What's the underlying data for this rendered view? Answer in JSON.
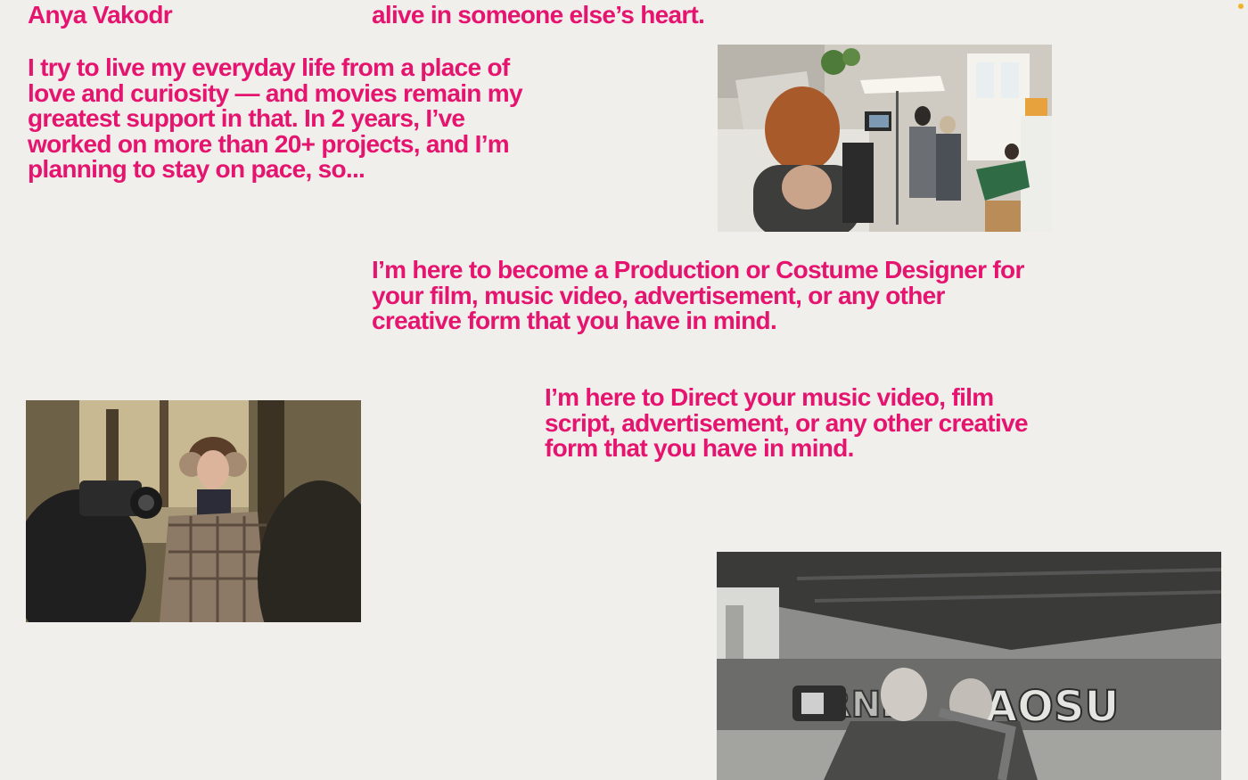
{
  "header": {
    "name": "Anya Vakodr",
    "quote_tail": "alive in someone else’s heart."
  },
  "intro": {
    "text": "I try to live my everyday life from a place of\nlove and curiosity  —  and movies remain my\ngreatest support in that. In 2 years, I’ve\nworked on more than 20+ projects, and I’m\nplanning to stay on pace, so..."
  },
  "production": {
    "text": "I’m here to become a Production or Costume Designer for\nyour film, music video, advertisement, or any other\ncreative form that you have in mind."
  },
  "director": {
    "text": "I’m here to Direct your music video, film\nscript, advertisement, or any other creative\nform that you have in mind."
  },
  "photos": {
    "kitchen": "film set in a kitchen photo",
    "park": "woman in winter coat with camera crew photo",
    "bridge": "black and white photo under graffiti bridge"
  },
  "colors": {
    "background": "#f0efeb",
    "accent": "#e5146f",
    "indicator": "#f2b225"
  }
}
